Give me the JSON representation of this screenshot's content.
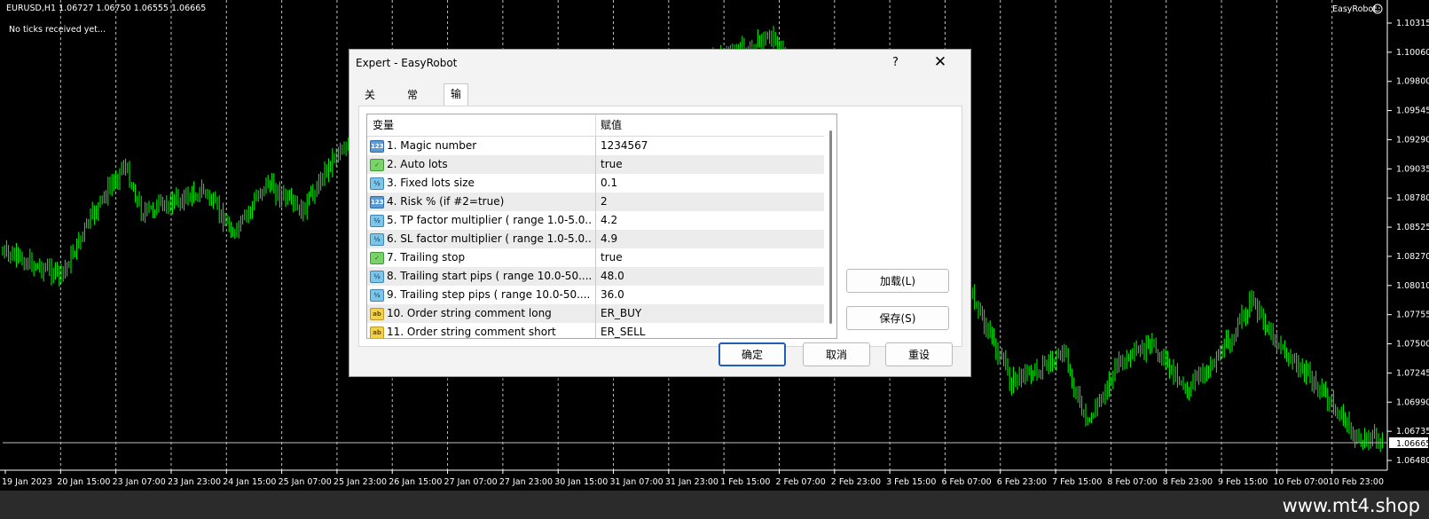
{
  "chart": {
    "header": "EURUSD,H1  1.06727 1.06750 1.06555 1.06665",
    "status": "No ticks received yet...",
    "expert_label": "EasyRobot",
    "price_labels": [
      "1.10315",
      "1.10060",
      "1.09800",
      "1.09545",
      "1.09290",
      "1.09035",
      "1.08780",
      "1.08525",
      "1.08270",
      "1.08010",
      "1.07755",
      "1.07500",
      "1.07245",
      "1.06990",
      "1.06735",
      "1.06665",
      "1.06480"
    ],
    "current_price": "1.06665",
    "time_labels": [
      "19 Jan 2023",
      "20 Jan 15:00",
      "23 Jan 07:00",
      "23 Jan 23:00",
      "24 Jan 15:00",
      "25 Jan 07:00",
      "25 Jan 23:00",
      "26 Jan 15:00",
      "27 Jan 07:00",
      "27 Jan 23:00",
      "30 Jan 15:00",
      "31 Jan 07:00",
      "31 Jan 23:00",
      "1 Feb 15:00",
      "2 Feb 07:00",
      "2 Feb 23:00",
      "3 Feb 15:00",
      "6 Feb 07:00",
      "6 Feb 23:00",
      "7 Feb 15:00",
      "8 Feb 07:00",
      "8 Feb 23:00",
      "9 Feb 15:00",
      "10 Feb 07:00",
      "10 Feb 23:00"
    ],
    "bar_color": "#00ff00"
  },
  "dialog": {
    "title": "Expert - EasyRobot",
    "help": "?",
    "close": "✕",
    "tabs": [
      "关于",
      "常用",
      "输入参数"
    ],
    "active_tab": "输入参数",
    "columns": {
      "variable": "变量",
      "value": "赋值"
    },
    "params": [
      {
        "type": "int",
        "icon": "123",
        "name": "1.    Magic number",
        "value": "1234567"
      },
      {
        "type": "bool",
        "icon": "✓",
        "name": "2.    Auto lots",
        "value": "true"
      },
      {
        "type": "dbl",
        "icon": "½",
        "name": "3.    Fixed lots size",
        "value": "0.1"
      },
      {
        "type": "int",
        "icon": "123",
        "name": "4.    Risk % (if #2=true)",
        "value": "2"
      },
      {
        "type": "dbl",
        "icon": "½",
        "name": "5.    TP factor multiplier ( range 1.0-5.0....",
        "value": "4.2"
      },
      {
        "type": "dbl",
        "icon": "½",
        "name": "6.    SL factor multiplier ( range 1.0-5.0....",
        "value": "4.9"
      },
      {
        "type": "bool",
        "icon": "✓",
        "name": "7.    Trailing stop",
        "value": "true"
      },
      {
        "type": "dbl",
        "icon": "½",
        "name": "8.    Trailing start pips ( range 10.0-50....",
        "value": "48.0"
      },
      {
        "type": "dbl",
        "icon": "½",
        "name": "9.    Trailing step pips ( range 10.0-50....",
        "value": "36.0"
      },
      {
        "type": "str",
        "icon": "ab",
        "name": "10. Order string comment long",
        "value": "ER_BUY"
      },
      {
        "type": "str",
        "icon": "ab",
        "name": "11. Order string comment short",
        "value": "ER_SELL"
      }
    ],
    "load_btn": "加载(L)",
    "save_btn": "保存(S)",
    "ok_btn": "确定",
    "cancel_btn": "取消",
    "reset_btn": "重设"
  },
  "footer": {
    "watermark": "www.mt4.shop"
  }
}
